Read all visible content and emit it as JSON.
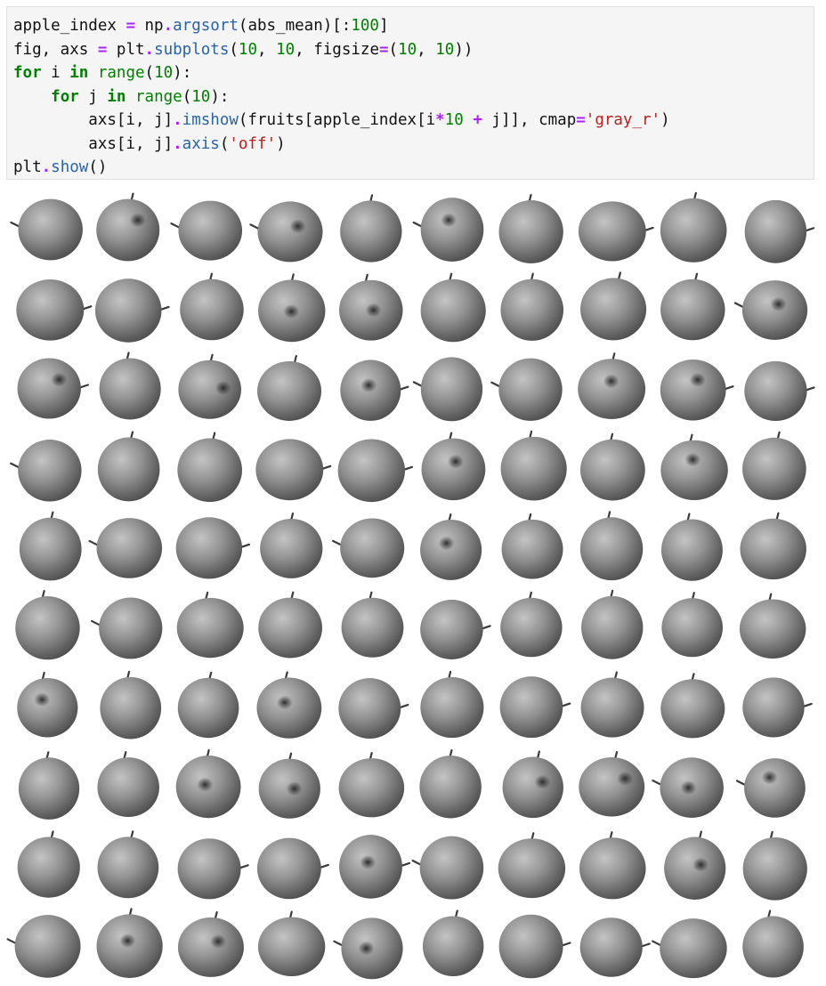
{
  "code_cell": {
    "lines": [
      [
        [
          "",
          "apple_index "
        ],
        [
          "op",
          "="
        ],
        [
          "",
          " np"
        ],
        [
          "op",
          "."
        ],
        [
          "fn",
          "argsort"
        ],
        [
          "",
          "(abs_mean)[:"
        ],
        [
          "num",
          "100"
        ],
        [
          "",
          "]"
        ]
      ],
      [
        [
          "",
          "fig, axs "
        ],
        [
          "op",
          "="
        ],
        [
          "",
          " plt"
        ],
        [
          "op",
          "."
        ],
        [
          "fn",
          "subplots"
        ],
        [
          "",
          "("
        ],
        [
          "num",
          "10"
        ],
        [
          "",
          ", "
        ],
        [
          "num",
          "10"
        ],
        [
          "",
          ", figsize"
        ],
        [
          "op",
          "="
        ],
        [
          "",
          "("
        ],
        [
          "num",
          "10"
        ],
        [
          "",
          ", "
        ],
        [
          "num",
          "10"
        ],
        [
          "",
          "))"
        ]
      ],
      [
        [
          "kw",
          "for"
        ],
        [
          "",
          " i "
        ],
        [
          "kw",
          "in"
        ],
        [
          "",
          " "
        ],
        [
          "bi",
          "range"
        ],
        [
          "",
          "("
        ],
        [
          "num",
          "10"
        ],
        [
          "",
          "):"
        ]
      ],
      [
        [
          "",
          "    "
        ],
        [
          "kw",
          "for"
        ],
        [
          "",
          " j "
        ],
        [
          "kw",
          "in"
        ],
        [
          "",
          " "
        ],
        [
          "bi",
          "range"
        ],
        [
          "",
          "("
        ],
        [
          "num",
          "10"
        ],
        [
          "",
          "):"
        ]
      ],
      [
        [
          "",
          "        axs[i, j]"
        ],
        [
          "op",
          "."
        ],
        [
          "fn",
          "imshow"
        ],
        [
          "",
          "(fruits[apple_index[i"
        ],
        [
          "op",
          "*"
        ],
        [
          "num",
          "10"
        ],
        [
          "",
          " "
        ],
        [
          "op",
          "+"
        ],
        [
          "",
          " j]], cmap"
        ],
        [
          "op",
          "="
        ],
        [
          "str",
          "'gray_r'"
        ],
        [
          "",
          ")"
        ]
      ],
      [
        [
          "",
          "        axs[i, j]"
        ],
        [
          "op",
          "."
        ],
        [
          "fn",
          "axis"
        ],
        [
          "",
          "("
        ],
        [
          "str",
          "'off'"
        ],
        [
          "",
          ")"
        ]
      ],
      [
        [
          "",
          "plt"
        ],
        [
          "op",
          "."
        ],
        [
          "fn",
          "show"
        ],
        [
          "",
          "()"
        ]
      ]
    ]
  },
  "output": {
    "grid_rows": 10,
    "grid_cols": 10,
    "image_subject": "apple",
    "colormap": "gray_r",
    "axis": "off"
  }
}
